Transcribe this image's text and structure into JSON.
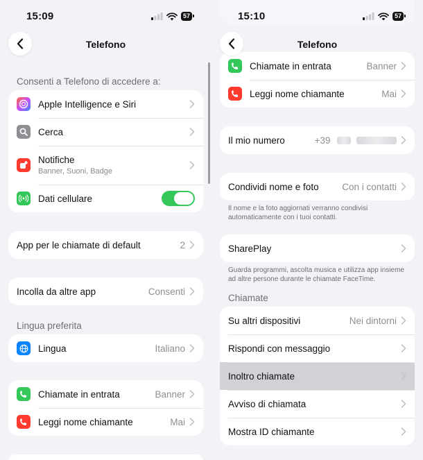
{
  "left": {
    "time": "15:09",
    "battery": "57",
    "title": "Telefono",
    "access_header": "Consenti a Telefono di accedere a:",
    "access_items": [
      {
        "label": "Apple Intelligence e Siri"
      },
      {
        "label": "Cerca"
      },
      {
        "label": "Notifiche",
        "sub": "Banner, Suoni, Badge"
      },
      {
        "label": "Dati cellulare",
        "toggle_on": true
      }
    ],
    "default_app": {
      "label": "App per le chiamate di default",
      "value": "2"
    },
    "paste": {
      "label": "Incolla da altre app",
      "value": "Consenti"
    },
    "language_header": "Lingua preferita",
    "language": {
      "label": "Lingua",
      "value": "Italiano"
    },
    "calls": [
      {
        "label": "Chiamate in entrata",
        "value": "Banner"
      },
      {
        "label": "Leggi nome chiamante",
        "value": "Mai"
      }
    ]
  },
  "right": {
    "time": "15:10",
    "battery": "57",
    "title": "Telefono",
    "calls": [
      {
        "label": "Chiamate in entrata",
        "value": "Banner"
      },
      {
        "label": "Leggi nome chiamante",
        "value": "Mai"
      }
    ],
    "my_number": {
      "label": "Il mio numero",
      "value_prefix": "+39"
    },
    "share": {
      "label": "Condividi nome e foto",
      "value": "Con i contatti"
    },
    "share_note": "Il nome e la foto aggiornati verranno condivisi automaticamente con i tuoi contatti.",
    "shareplay": {
      "label": "SharePlay"
    },
    "shareplay_note": "Guarda programmi, ascolta musica e utilizza app insieme ad altre persone durante le chiamate FaceTime.",
    "calls_header": "Chiamate",
    "call_settings": [
      {
        "label": "Su altri dispositivi",
        "value": "Nei dintorni"
      },
      {
        "label": "Rispondi con messaggio",
        "value": ""
      },
      {
        "label": "Inoltro chiamate",
        "value": "",
        "highlighted": true
      },
      {
        "label": "Avviso di chiamata",
        "value": ""
      },
      {
        "label": "Mostra ID chiamante",
        "value": ""
      }
    ]
  },
  "colors": {
    "background": "#f2f2f7",
    "toggle_on": "#34c759",
    "phone_green": "#34c759",
    "call_red": "#ff3b30",
    "globe_blue": "#0a84ff",
    "search_gray": "#8e8e93",
    "highlight": "#d1d1d6"
  },
  "icons": [
    "back-chevron-icon",
    "siri-icon",
    "search-icon",
    "notification-icon",
    "cellular-icon",
    "globe-icon",
    "incoming-call-icon",
    "announce-caller-icon",
    "signal-icon",
    "wifi-icon",
    "battery-icon",
    "chevron-right-icon"
  ]
}
